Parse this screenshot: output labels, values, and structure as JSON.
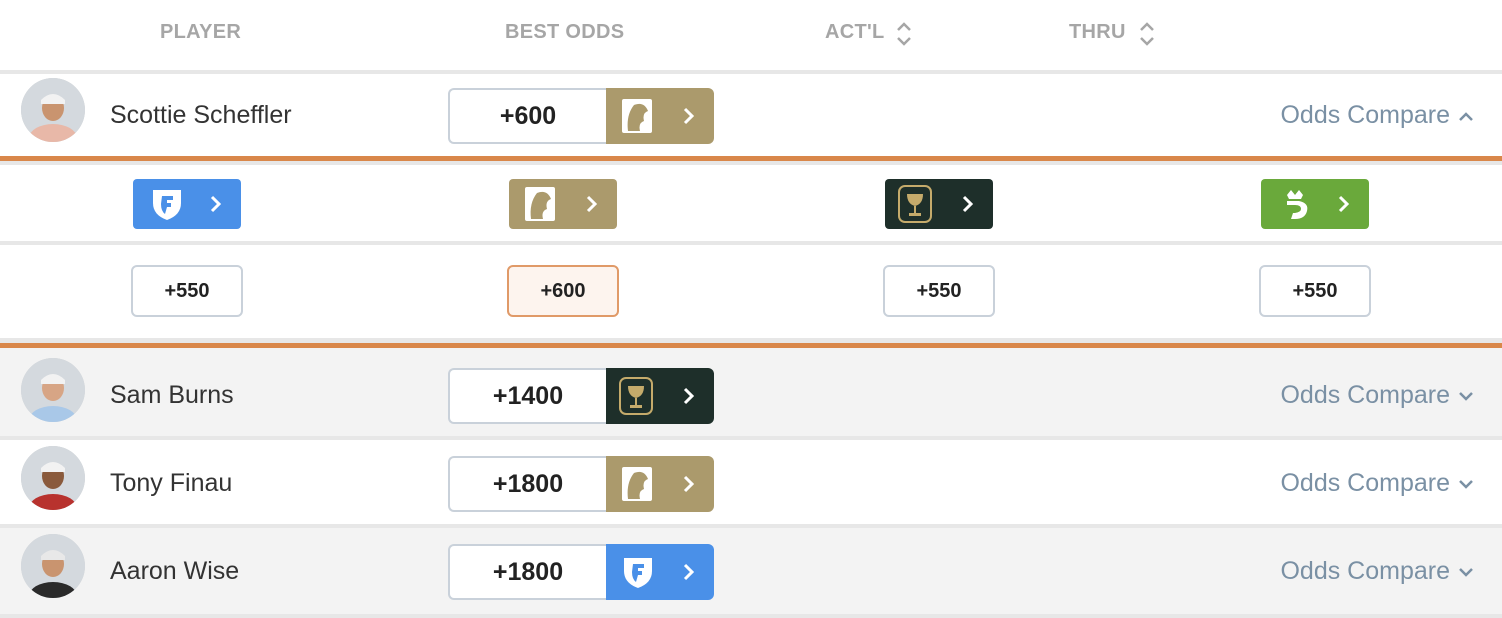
{
  "header": {
    "player": "PLAYER",
    "best_odds": "BEST ODDS",
    "actual": "ACT'L",
    "thru": "THRU"
  },
  "colors": {
    "fanduel": "#4a90e8",
    "betmgm": "#ab9a6c",
    "caesars": "#1e2f2a",
    "draftkings": "#6aa93b",
    "accent": "#d9874a",
    "link": "#7a90a4"
  },
  "players": [
    {
      "name": "Scottie Scheffler",
      "best_odds": "+600",
      "book": "betmgm",
      "compare_label": "Odds Compare",
      "expanded": true
    },
    {
      "name": "Sam Burns",
      "best_odds": "+1400",
      "book": "caesars",
      "compare_label": "Odds Compare",
      "expanded": false
    },
    {
      "name": "Tony Finau",
      "best_odds": "+1800",
      "book": "betmgm",
      "compare_label": "Odds Compare",
      "expanded": false
    },
    {
      "name": "Aaron Wise",
      "best_odds": "+1800",
      "book": "fanduel",
      "compare_label": "Odds Compare",
      "expanded": false
    }
  ],
  "compare": {
    "books": [
      "fanduel",
      "betmgm",
      "caesars",
      "draftkings"
    ],
    "odds": [
      "+550",
      "+600",
      "+550",
      "+550"
    ],
    "best_index": 1
  }
}
